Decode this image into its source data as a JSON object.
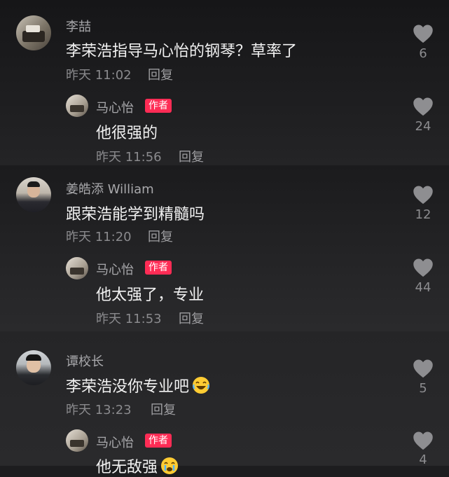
{
  "comments": [
    {
      "user": "李喆",
      "text": "李荣浩指导马心怡的钢琴？草率了",
      "time": "昨天 11:02",
      "reply_label": "回复",
      "likes": "6",
      "reply": {
        "user": "马心怡",
        "badge": "作者",
        "text": "他很强的",
        "time": "昨天 11:56",
        "reply_label": "回复",
        "likes": "24"
      }
    },
    {
      "user": "姜皓添 William",
      "text": "跟荣浩能学到精髓吗",
      "time": "昨天 11:20",
      "reply_label": "回复",
      "likes": "12",
      "reply": {
        "user": "马心怡",
        "badge": "作者",
        "text": "他太强了，专业",
        "time": "昨天 11:53",
        "reply_label": "回复",
        "likes": "44"
      }
    },
    {
      "user": "谭校长",
      "text": "李荣浩没你专业吧",
      "time": "昨天 13:23",
      "reply_label": "回复",
      "likes": "5",
      "reply": {
        "user": "马心怡",
        "badge": "作者",
        "text": "他无敌强",
        "likes": "4"
      }
    }
  ],
  "colors": {
    "badge": "#fe2c55",
    "like_icon": "#8e8e91"
  }
}
